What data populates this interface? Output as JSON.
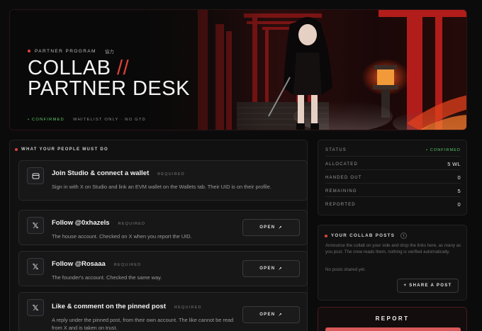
{
  "hero": {
    "eyebrow": "PARTNER PROGRAM",
    "eyebrow_kanji": "協力",
    "title_line1": "COLLAB",
    "title_slash": "//",
    "title_line2": "PARTNER DESK",
    "confirmed": "CONFIRMED",
    "meta": "WHITELIST ONLY · NO GTD"
  },
  "tasks_section": {
    "label": "WHAT YOUR PEOPLE MUST DO",
    "required_label": "REQUIRED",
    "open_label": "OPEN",
    "tasks": [
      {
        "title": "Join Studio & connect a wallet",
        "desc": "Sign in with X on Studio and link an EVM wallet on the Wallets tab. Their UID is on their profile.",
        "icon": "wallet-icon"
      },
      {
        "title": "Follow @0xhazels",
        "desc": "The house account. Checked on X when you report the UID.",
        "icon": "x-logo-icon"
      },
      {
        "title": "Follow @Rosaaa",
        "desc": "The founder's account. Checked the same way.",
        "icon": "x-logo-icon"
      },
      {
        "title": "Like & comment on the pinned post",
        "desc": "A reply under the pinned post, from their own account. The like cannot be read from X and is taken on trust.",
        "icon": "x-logo-icon"
      }
    ]
  },
  "status": {
    "rows": [
      {
        "label": "STATUS",
        "value": "CONFIRMED"
      },
      {
        "label": "ALLOCATED",
        "value": "5 WL"
      },
      {
        "label": "HANDED OUT",
        "value": "0"
      },
      {
        "label": "REMAINING",
        "value": "5"
      },
      {
        "label": "REPORTED",
        "value": "0"
      }
    ]
  },
  "posts": {
    "title": "YOUR COLLAB POSTS",
    "desc": "Announce the collab on your side and drop the links here, as many as you post. The crew reads them, nothing is verified automatically.",
    "empty": "No posts shared yet.",
    "share_label": "SHARE A POST"
  },
  "report": {
    "label": "REPORT"
  },
  "colors": {
    "accent": "#e0433a",
    "confirmed": "#5ecb6a",
    "report_bar": "#d9585a"
  }
}
